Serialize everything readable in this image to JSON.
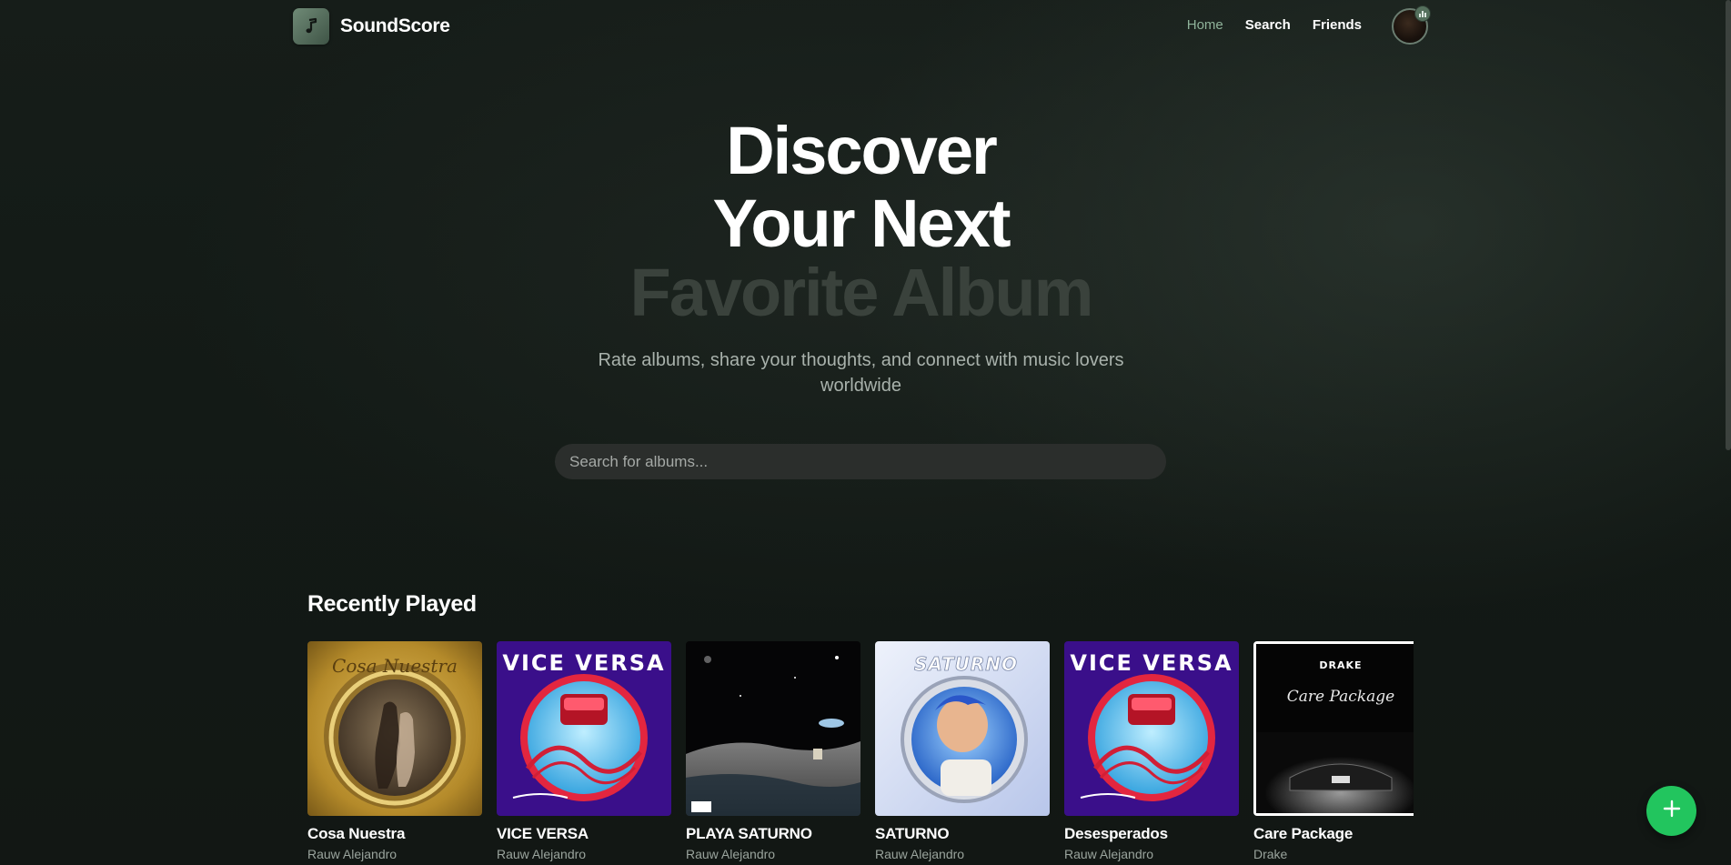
{
  "app": {
    "name": "SoundScore"
  },
  "nav": {
    "items": [
      {
        "label": "Home",
        "active": true
      },
      {
        "label": "Search",
        "active": false
      },
      {
        "label": "Friends",
        "active": false
      }
    ]
  },
  "hero": {
    "line1": "Discover",
    "line2": "Your Next",
    "line3": "Favorite Album",
    "subtitle_line1": "Rate albums, share your thoughts, and connect with music lovers",
    "subtitle_line2": "worldwide"
  },
  "search": {
    "placeholder": "Search for albums...",
    "value": ""
  },
  "recently_played": {
    "title": "Recently Played",
    "albums": [
      {
        "title": "Cosa Nuestra",
        "artist": "Rauw Alejandro"
      },
      {
        "title": "VICE VERSA",
        "artist": "Rauw Alejandro"
      },
      {
        "title": "PLAYA SATURNO",
        "artist": "Rauw Alejandro"
      },
      {
        "title": "SATURNO",
        "artist": "Rauw Alejandro"
      },
      {
        "title": "Desesperados",
        "artist": "Rauw Alejandro"
      },
      {
        "title": "Care Package",
        "artist": "Drake"
      }
    ]
  },
  "cover_art_text": {
    "cosa_nuestra": "Cosa Nuestra",
    "vice_versa": "VICE VERSA",
    "saturno": "SATURNO",
    "drake": "DRAKE",
    "care_package": "Care Package"
  },
  "icons": {
    "brand_logo": "music-note-icon",
    "fab": "plus-icon",
    "avatar_badge": "bar-chart-icon"
  },
  "colors": {
    "accent": "#22c55e",
    "nav_active": "#8fb39a",
    "background": "#121714",
    "hero_dim": "#3a423c"
  }
}
